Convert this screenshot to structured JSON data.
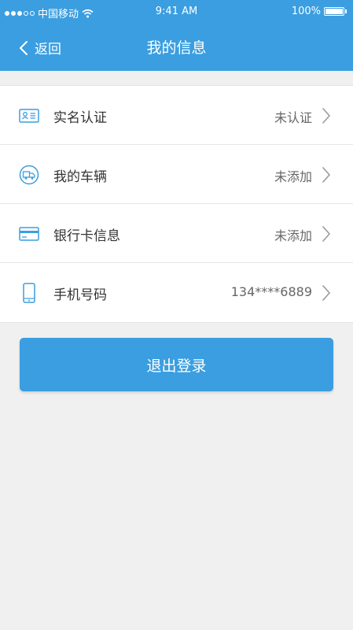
{
  "status_bar": {
    "carrier": "中国移动",
    "time": "9:41 AM",
    "battery": "100%",
    "battery_level": 1.0,
    "signal_full": 3,
    "signal_total": 5
  },
  "nav": {
    "back_label": "返回",
    "title": "我的信息",
    "back_icon": "chevron-left-icon"
  },
  "list": [
    {
      "label": "实名认证",
      "value": "未认证",
      "icon": "id-card-icon"
    },
    {
      "label": "我的车辆",
      "value": "未添加",
      "icon": "truck-icon"
    },
    {
      "label": "银行卡信息",
      "value": "未添加",
      "icon": "bank-card-icon"
    },
    {
      "label": "手机号码",
      "value": "134****6889",
      "icon": "phone-icon"
    }
  ],
  "logout": {
    "label": "退出登录"
  },
  "colors": {
    "primary": "#3b9ee0",
    "background": "#f0f0f0",
    "text": "#333333",
    "secondary_text": "#666666"
  }
}
